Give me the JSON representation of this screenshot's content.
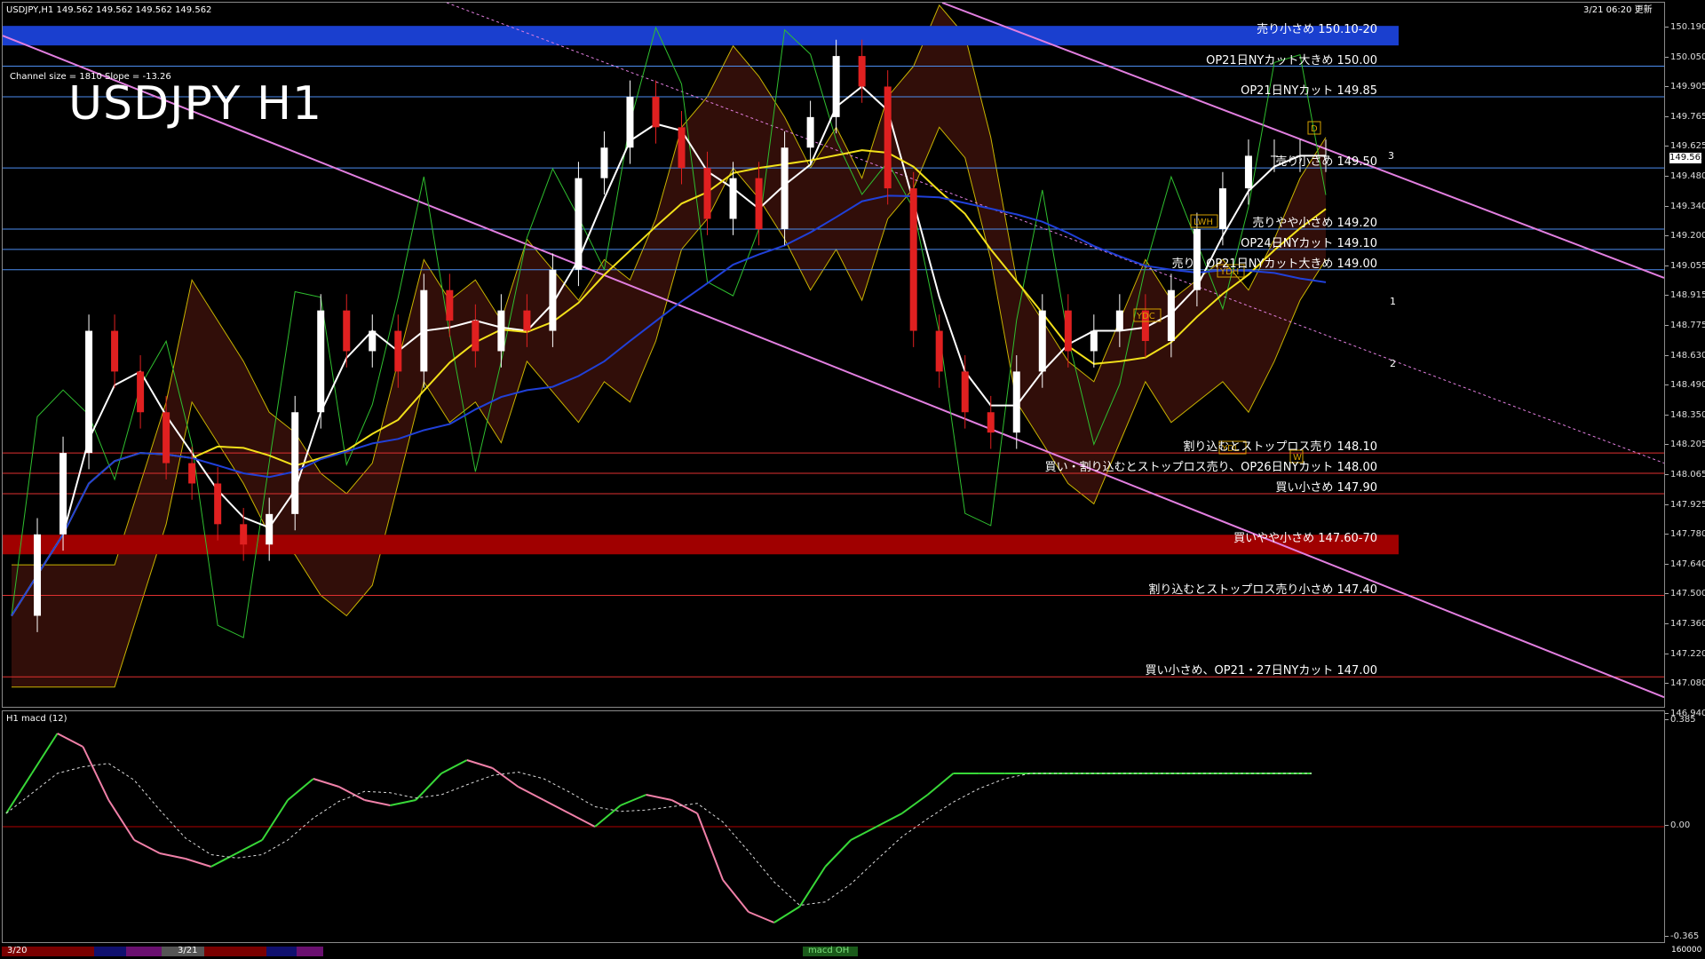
{
  "header": {
    "symbol_line": "USDJPY,H1  149.562 149.562 149.562 149.562",
    "datetime": "3/21 06:20 更新",
    "title": "USDJPY H1",
    "channel_info": "Channel size = 1810  Slope = -13.26"
  },
  "main": {
    "current_price": "149.562",
    "price_ticks": [
      "150.190",
      "150.050",
      "149.905",
      "149.765",
      "149.625",
      "149.480",
      "149.340",
      "149.200",
      "149.055",
      "148.915",
      "148.775",
      "148.630",
      "148.490",
      "148.350",
      "148.205",
      "148.065",
      "147.925",
      "147.780",
      "147.640",
      "147.500",
      "147.360",
      "147.220",
      "147.080",
      "146.940"
    ],
    "levels": [
      {
        "label": "売り小さめ 150.10-20",
        "price": 150.15,
        "color": "#1a3fcf",
        "kind": "band"
      },
      {
        "label": "OP21日NYカット大きめ 150.00",
        "price": 150.0,
        "color": "#4c8df0",
        "kind": "line"
      },
      {
        "label": "OP21日NYカット 149.85",
        "price": 149.85,
        "color": "#4c8df0",
        "kind": "line"
      },
      {
        "label": "売り小さめ 149.50",
        "price": 149.5,
        "color": "#4c8df0",
        "kind": "line"
      },
      {
        "label": "売りやや小さめ 149.20",
        "price": 149.2,
        "color": "#4c8df0",
        "kind": "line"
      },
      {
        "label": "OP24日NYカット 149.10",
        "price": 149.1,
        "color": "#4c8df0",
        "kind": "line"
      },
      {
        "label": "売り、OP21日NYカット大きめ 149.00",
        "price": 149.0,
        "color": "#4c8df0",
        "kind": "line"
      },
      {
        "label": "割り込むとストップロス売り 148.10",
        "price": 148.1,
        "color": "#e03030",
        "kind": "line"
      },
      {
        "label": "買い・割り込むとストップロス売り、OP26日NYカット 148.00",
        "price": 148.0,
        "color": "#e03030",
        "kind": "line"
      },
      {
        "label": "買い小さめ 147.90",
        "price": 147.9,
        "color": "#e03030",
        "kind": "line"
      },
      {
        "label": "買いやや小さめ 147.60-70",
        "price": 147.65,
        "color": "#a00000",
        "kind": "band"
      },
      {
        "label": "割り込むとストップロス売り小さめ 147.40",
        "price": 147.4,
        "color": "#e03030",
        "kind": "line"
      },
      {
        "label": "買い小さめ、OP21・27日NYカット 147.00",
        "price": 147.0,
        "color": "#e03030",
        "kind": "line"
      }
    ],
    "box_labels": [
      "LWH",
      "YDH",
      "YDC",
      "YDL",
      "W",
      "D"
    ],
    "channel_numbers": [
      "1",
      "2",
      "3"
    ]
  },
  "macd": {
    "title": "H1 macd (12)",
    "ticks": [
      "0.385",
      "0.00",
      "-0.365"
    ]
  },
  "timebar": {
    "labels": [
      "3/20",
      "3/21",
      "macd OH"
    ],
    "right_value": "160000"
  },
  "chart_data": {
    "type": "line",
    "title": "USDJPY H1",
    "ylim": [
      146.94,
      150.19
    ],
    "x": [
      0,
      6,
      12,
      18,
      24,
      30,
      36,
      42,
      48,
      54,
      60,
      66,
      72,
      78,
      84,
      90,
      96,
      102,
      108,
      114,
      120,
      126,
      132,
      138,
      144,
      150,
      156,
      162,
      168,
      174,
      180,
      186,
      192,
      198,
      204,
      210,
      216,
      222,
      228,
      234,
      240,
      246,
      252,
      258,
      264,
      270,
      276,
      282,
      288,
      294,
      300,
      306
    ],
    "series": [
      {
        "name": "close",
        "values": [
          147.3,
          147.7,
          148.1,
          148.7,
          148.5,
          148.3,
          148.05,
          147.95,
          147.75,
          147.65,
          147.8,
          148.3,
          148.8,
          148.6,
          148.7,
          148.5,
          148.9,
          148.75,
          148.6,
          148.8,
          148.7,
          149.0,
          149.45,
          149.6,
          149.85,
          149.7,
          149.5,
          149.25,
          149.45,
          149.2,
          149.6,
          149.75,
          150.05,
          149.9,
          149.4,
          148.7,
          148.5,
          148.3,
          148.2,
          148.5,
          148.8,
          148.6,
          148.7,
          148.8,
          148.65,
          148.9,
          149.2,
          149.4,
          149.56,
          149.56,
          149.56,
          149.56
        ]
      },
      {
        "name": "macd",
        "values": [
          0.05,
          0.2,
          0.35,
          0.3,
          0.1,
          -0.05,
          -0.1,
          -0.12,
          -0.15,
          -0.1,
          -0.05,
          0.1,
          0.18,
          0.15,
          0.1,
          0.08,
          0.1,
          0.2,
          0.25,
          0.22,
          0.15,
          0.1,
          0.05,
          0.0,
          0.08,
          0.12,
          0.1,
          0.05,
          -0.2,
          -0.32,
          -0.36,
          -0.3,
          -0.15,
          -0.05,
          0.0,
          0.05,
          0.12,
          0.2,
          0.2,
          0.2,
          0.2,
          0.2,
          0.2,
          0.2,
          0.2,
          0.2,
          0.2,
          0.2,
          0.2,
          0.2,
          0.2,
          0.2
        ]
      }
    ]
  }
}
